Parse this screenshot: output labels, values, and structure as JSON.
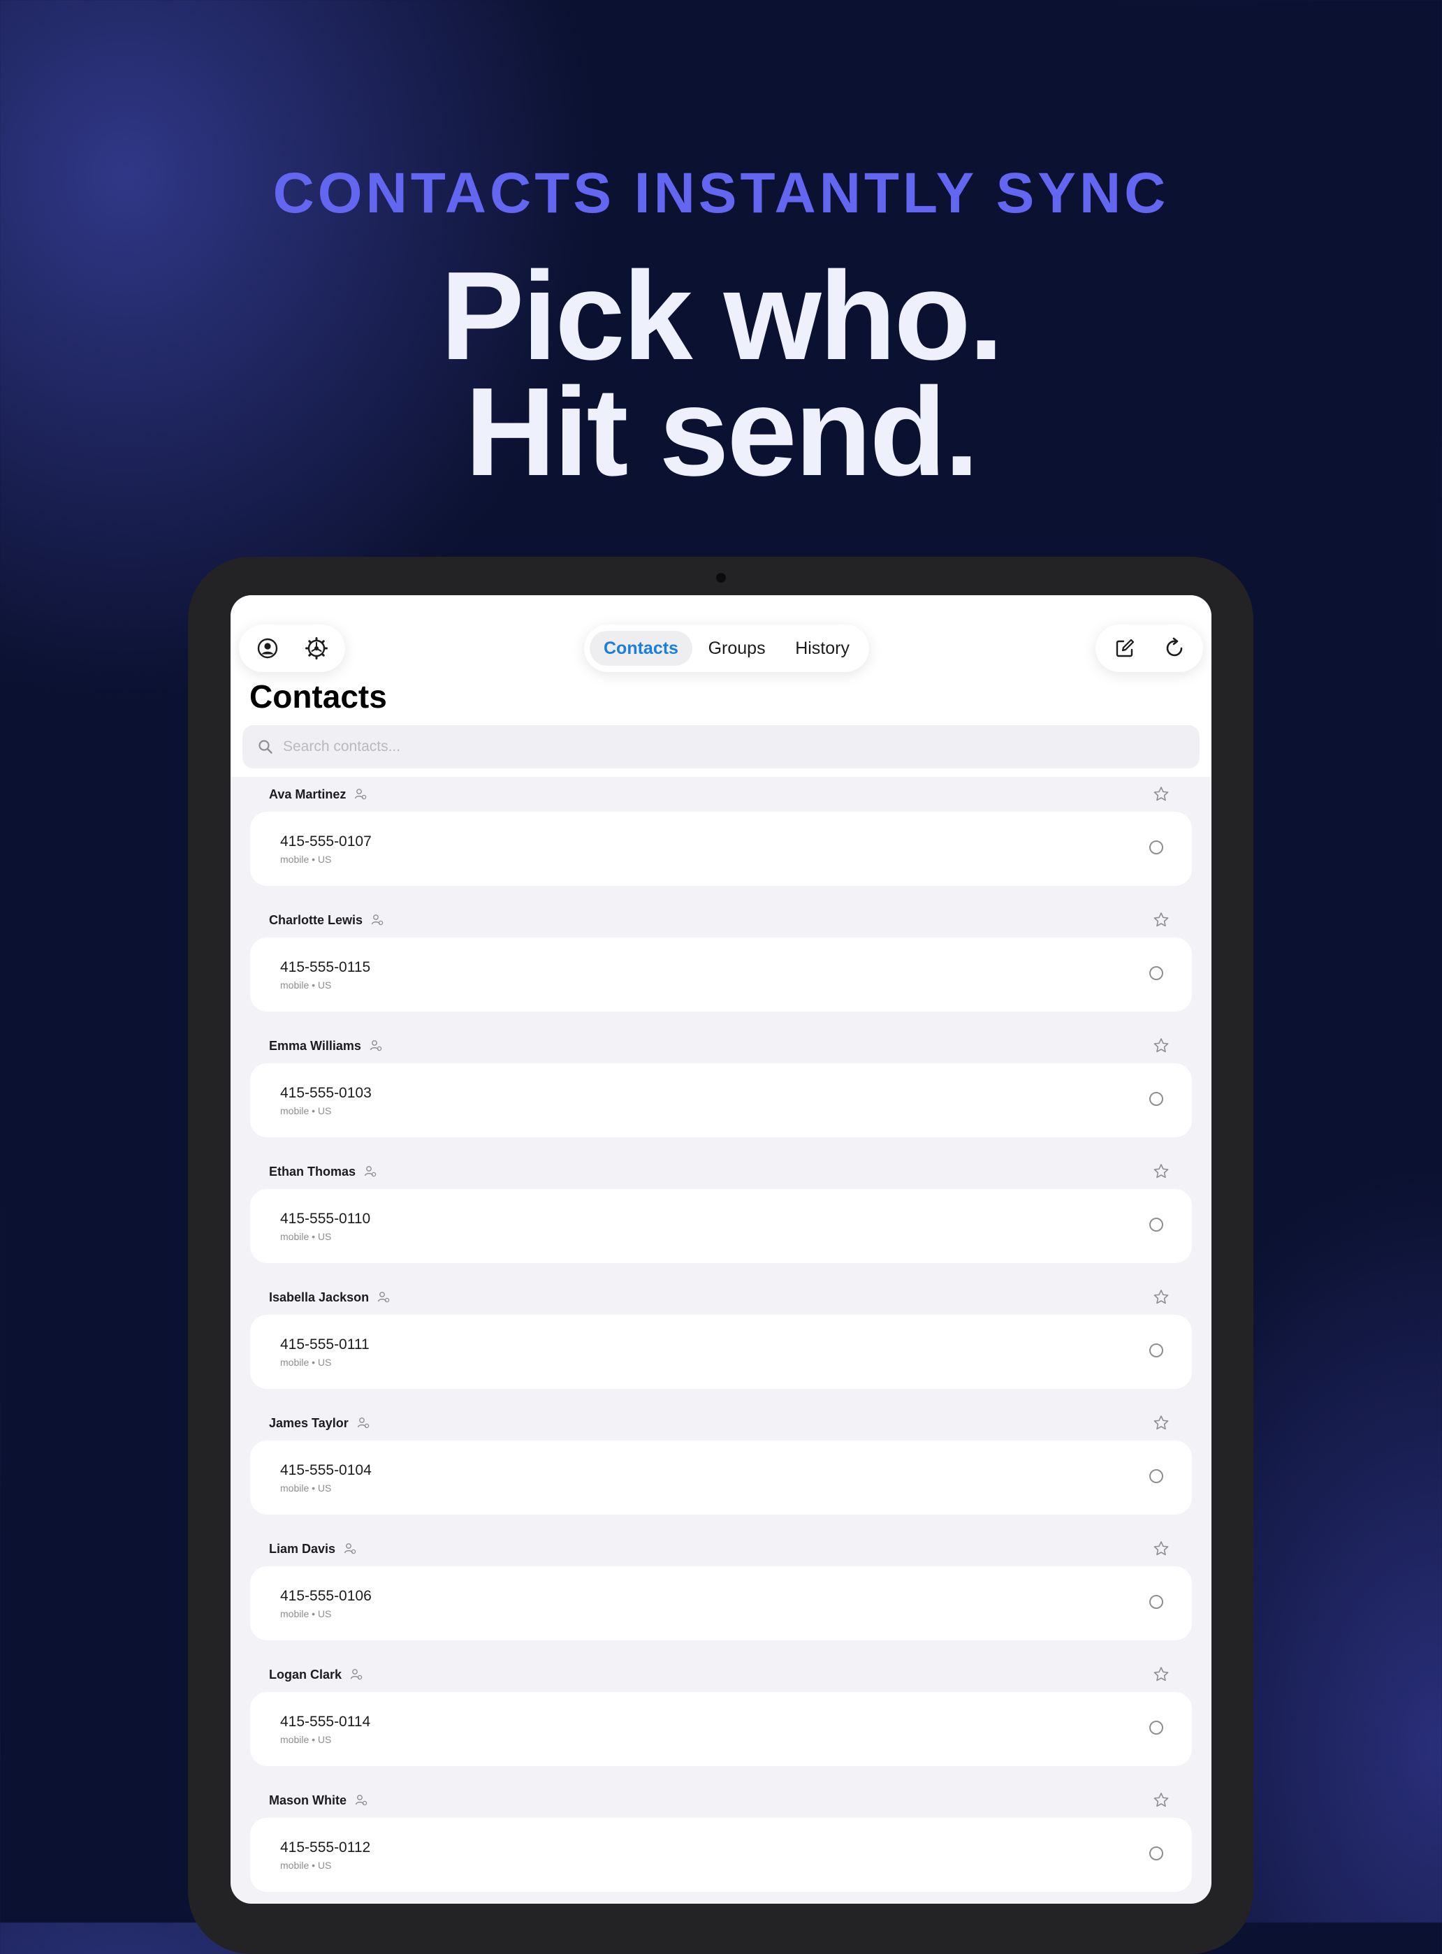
{
  "marketing": {
    "kicker": "CONTACTS INSTANTLY SYNC",
    "headline_line1": "Pick who.",
    "headline_line2": "Hit send."
  },
  "toolbar": {
    "left_icons": [
      "profile-icon",
      "settings-gear-icon"
    ],
    "right_icons": [
      "compose-icon",
      "refresh-icon"
    ]
  },
  "tabs": [
    {
      "label": "Contacts",
      "active": true
    },
    {
      "label": "Groups",
      "active": false
    },
    {
      "label": "History",
      "active": false
    }
  ],
  "page": {
    "title": "Contacts"
  },
  "search": {
    "placeholder": "Search contacts..."
  },
  "colors": {
    "accent": "#1a7fdc",
    "kicker": "#6366f1",
    "background": "#0b1130",
    "device": "#232325"
  },
  "contacts": [
    {
      "name": "Ava Martinez",
      "phone": "415-555-0107",
      "meta": "mobile • US"
    },
    {
      "name": "Charlotte Lewis",
      "phone": "415-555-0115",
      "meta": "mobile • US"
    },
    {
      "name": "Emma Williams",
      "phone": "415-555-0103",
      "meta": "mobile • US"
    },
    {
      "name": "Ethan Thomas",
      "phone": "415-555-0110",
      "meta": "mobile • US"
    },
    {
      "name": "Isabella Jackson",
      "phone": "415-555-0111",
      "meta": "mobile • US"
    },
    {
      "name": "James Taylor",
      "phone": "415-555-0104",
      "meta": "mobile • US"
    },
    {
      "name": "Liam Davis",
      "phone": "415-555-0106",
      "meta": "mobile • US"
    },
    {
      "name": "Logan Clark",
      "phone": "415-555-0114",
      "meta": "mobile • US"
    },
    {
      "name": "Mason White",
      "phone": "415-555-0112",
      "meta": "mobile • US"
    }
  ]
}
